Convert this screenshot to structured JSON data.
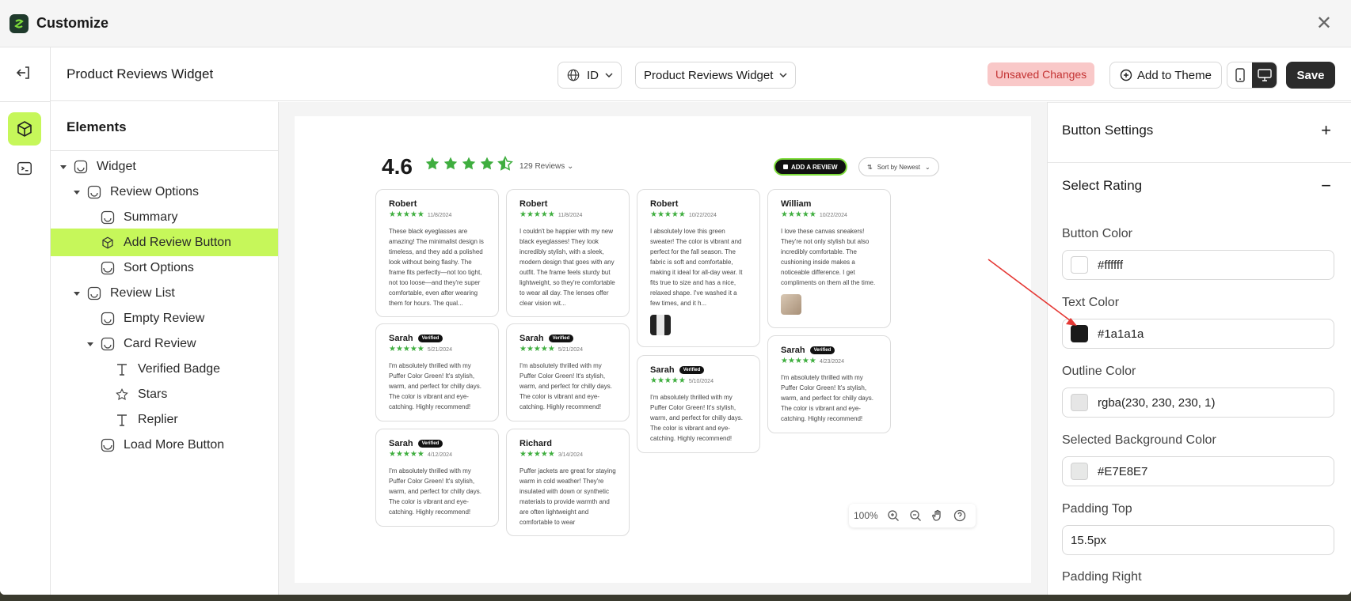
{
  "window": {
    "title": "Customize"
  },
  "toolbar": {
    "page_title": "Product Reviews Widget",
    "language": "ID",
    "widget_select": "Product Reviews Widget",
    "unsaved": "Unsaved Changes",
    "add_to_theme": "Add to Theme",
    "save": "Save"
  },
  "elements": {
    "title": "Elements",
    "tree": [
      {
        "label": "Widget"
      },
      {
        "label": "Review Options"
      },
      {
        "label": "Summary"
      },
      {
        "label": "Add Review Button"
      },
      {
        "label": "Sort Options"
      },
      {
        "label": "Review List"
      },
      {
        "label": "Empty Review"
      },
      {
        "label": "Card Review"
      },
      {
        "label": "Verified Badge"
      },
      {
        "label": "Stars"
      },
      {
        "label": "Replier"
      },
      {
        "label": "Load More Button"
      }
    ]
  },
  "preview": {
    "rating": "4.6",
    "reviews_count": "129 Reviews",
    "add_review": "ADD A REVIEW",
    "sort": "Sort by Newest",
    "verified_label": "Verified",
    "cards": [
      {
        "name": "Robert",
        "date": "11/8/2024",
        "text": "These black eyeglasses are amazing! The minimalist design is timeless, and they add a polished look without being flashy. The frame fits perfectly—not too tight, not too loose—and they're super comfortable, even after wearing them for hours. The qual..."
      },
      {
        "name": "Robert",
        "date": "11/8/2024",
        "text": "I couldn't be happier with my new black eyeglasses! They look incredibly stylish, with a sleek, modern design that goes with any outfit. The frame feels sturdy but lightweight, so they're comfortable to wear all day. The lenses offer clear vision wit..."
      },
      {
        "name": "Robert",
        "date": "10/22/2024",
        "text": "I absolutely love this green sweater! The color is vibrant and perfect for the fall season. The fabric is soft and comfortable, making it ideal for all-day wear. It fits true to size and has a nice, relaxed shape. I've washed it a few times, and it h..."
      },
      {
        "name": "William",
        "date": "10/22/2024",
        "text": "I love these canvas sneakers! They're not only stylish but also incredibly comfortable. The cushioning inside makes a noticeable difference. I get compliments on them all the time."
      },
      {
        "name": "Sarah",
        "date": "5/21/2024",
        "text": "I'm absolutely thrilled with my Puffer Color Green! It's stylish, warm, and perfect for chilly days. The color is vibrant and eye-catching. Highly recommend!"
      },
      {
        "name": "Sarah",
        "date": "5/21/2024",
        "text": "I'm absolutely thrilled with my Puffer Color Green! It's stylish, warm, and perfect for chilly days. The color is vibrant and eye-catching. Highly recommend!"
      },
      {
        "name": "Sarah",
        "date": "5/10/2024",
        "text": "I'm absolutely thrilled with my Puffer Color Green! It's stylish, warm, and perfect for chilly days. The color is vibrant and eye-catching. Highly recommend!"
      },
      {
        "name": "Sarah",
        "date": "4/23/2024",
        "text": "I'm absolutely thrilled with my Puffer Color Green! It's stylish, warm, and perfect for chilly days. The color is vibrant and eye-catching. Highly recommend!"
      },
      {
        "name": "Sarah",
        "date": "4/12/2024",
        "text": "I'm absolutely thrilled with my Puffer Color Green! It's stylish, warm, and perfect for chilly days. The color is vibrant and eye-catching. Highly recommend!"
      },
      {
        "name": "Richard",
        "date": "3/14/2024",
        "text": "Puffer jackets are great for staying warm in cold weather! They're insulated with down or synthetic materials to provide warmth and are often lightweight and comfortable to wear"
      }
    ],
    "zoom": "100%"
  },
  "settings": {
    "button_settings": "Button Settings",
    "select_rating": "Select Rating",
    "fields": [
      {
        "label": "Button Color",
        "value": "#ffffff",
        "swatch": "#ffffff"
      },
      {
        "label": "Text Color",
        "value": "#1a1a1a",
        "swatch": "#1a1a1a"
      },
      {
        "label": "Outline Color",
        "value": "rgba(230, 230, 230, 1)",
        "swatch": "#e6e6e6"
      },
      {
        "label": "Selected Background Color",
        "value": "#E7E8E7",
        "swatch": "#e7e8e7"
      },
      {
        "label": "Padding Top",
        "value": "15.5px"
      },
      {
        "label": "Padding Right"
      }
    ]
  },
  "colors": {
    "accent": "#c6f75a",
    "star": "#3fae3f",
    "annotation": "#e53935"
  }
}
